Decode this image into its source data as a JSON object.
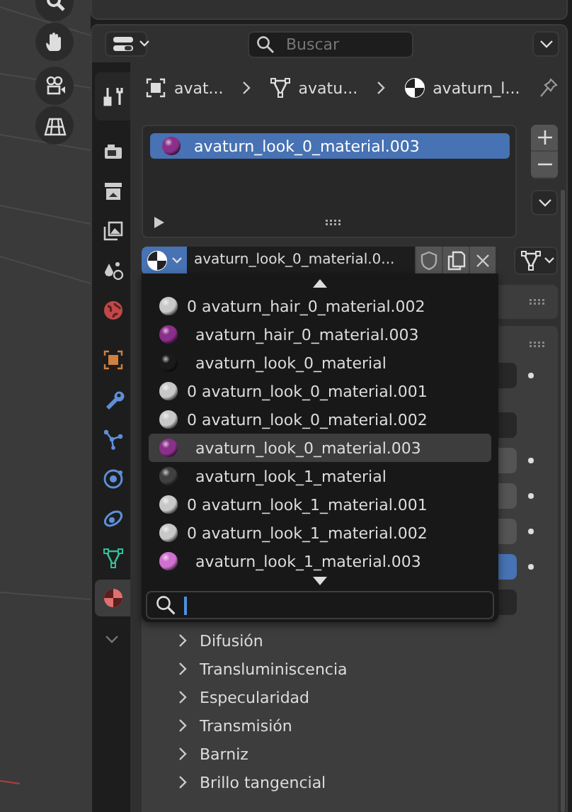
{
  "header": {
    "search_placeholder": "Buscar"
  },
  "tabs": [
    {
      "kind": "tool",
      "selected": false
    },
    {
      "kind": "render",
      "selected": false
    },
    {
      "kind": "output",
      "selected": false
    },
    {
      "kind": "view_layer",
      "selected": false
    },
    {
      "kind": "scene",
      "selected": false
    },
    {
      "kind": "world",
      "selected": false
    },
    {
      "kind": "object",
      "selected": false
    },
    {
      "kind": "modifiers",
      "selected": false
    },
    {
      "kind": "particles",
      "selected": false
    },
    {
      "kind": "physics",
      "selected": false
    },
    {
      "kind": "constraints",
      "selected": false
    },
    {
      "kind": "data",
      "selected": false
    },
    {
      "kind": "material",
      "selected": true
    }
  ],
  "breadcrumb": [
    {
      "kind": "object",
      "label": "avat..."
    },
    {
      "kind": "mesh",
      "label": "avatu..."
    },
    {
      "kind": "material",
      "label": "avaturn_l..."
    }
  ],
  "material_slots": [
    {
      "name": "avaturn_look_0_material.003",
      "color": "#8a2f8a",
      "selected": true
    }
  ],
  "material_field": {
    "value": "avaturn_look_0_material.0..."
  },
  "dropdown": {
    "items": [
      {
        "count": "0",
        "name": "avaturn_hair_0_material.002",
        "color": "#c8c8c8",
        "selected": false
      },
      {
        "name": "avaturn_hair_0_material.003",
        "color": "#8a2f8a",
        "selected": false
      },
      {
        "name": "avaturn_look_0_material",
        "color": "#1a1a1a",
        "selected": false
      },
      {
        "count": "0",
        "name": "avaturn_look_0_material.001",
        "color": "#c8c8c8",
        "selected": false
      },
      {
        "count": "0",
        "name": "avaturn_look_0_material.002",
        "color": "#c8c8c8",
        "selected": false
      },
      {
        "name": "avaturn_look_0_material.003",
        "color": "#8a2f8a",
        "selected": true
      },
      {
        "name": "avaturn_look_1_material",
        "color": "#404040",
        "selected": false
      },
      {
        "count": "0",
        "name": "avaturn_look_1_material.001",
        "color": "#c8c8c8",
        "selected": false
      },
      {
        "count": "0",
        "name": "avaturn_look_1_material.002",
        "color": "#c8c8c8",
        "selected": false
      },
      {
        "name": "avaturn_look_1_material.003",
        "color": "#d070d0",
        "selected": false
      }
    ]
  },
  "subpanels": [
    {
      "label": "Difusión",
      "expanded": false
    },
    {
      "label": "Transluminiscencia",
      "expanded": false
    },
    {
      "label": "Especularidad",
      "expanded": false
    },
    {
      "label": "Transmisión",
      "expanded": false
    },
    {
      "label": "Barniz",
      "expanded": false
    },
    {
      "label": "Brillo tangencial",
      "expanded": false
    }
  ]
}
